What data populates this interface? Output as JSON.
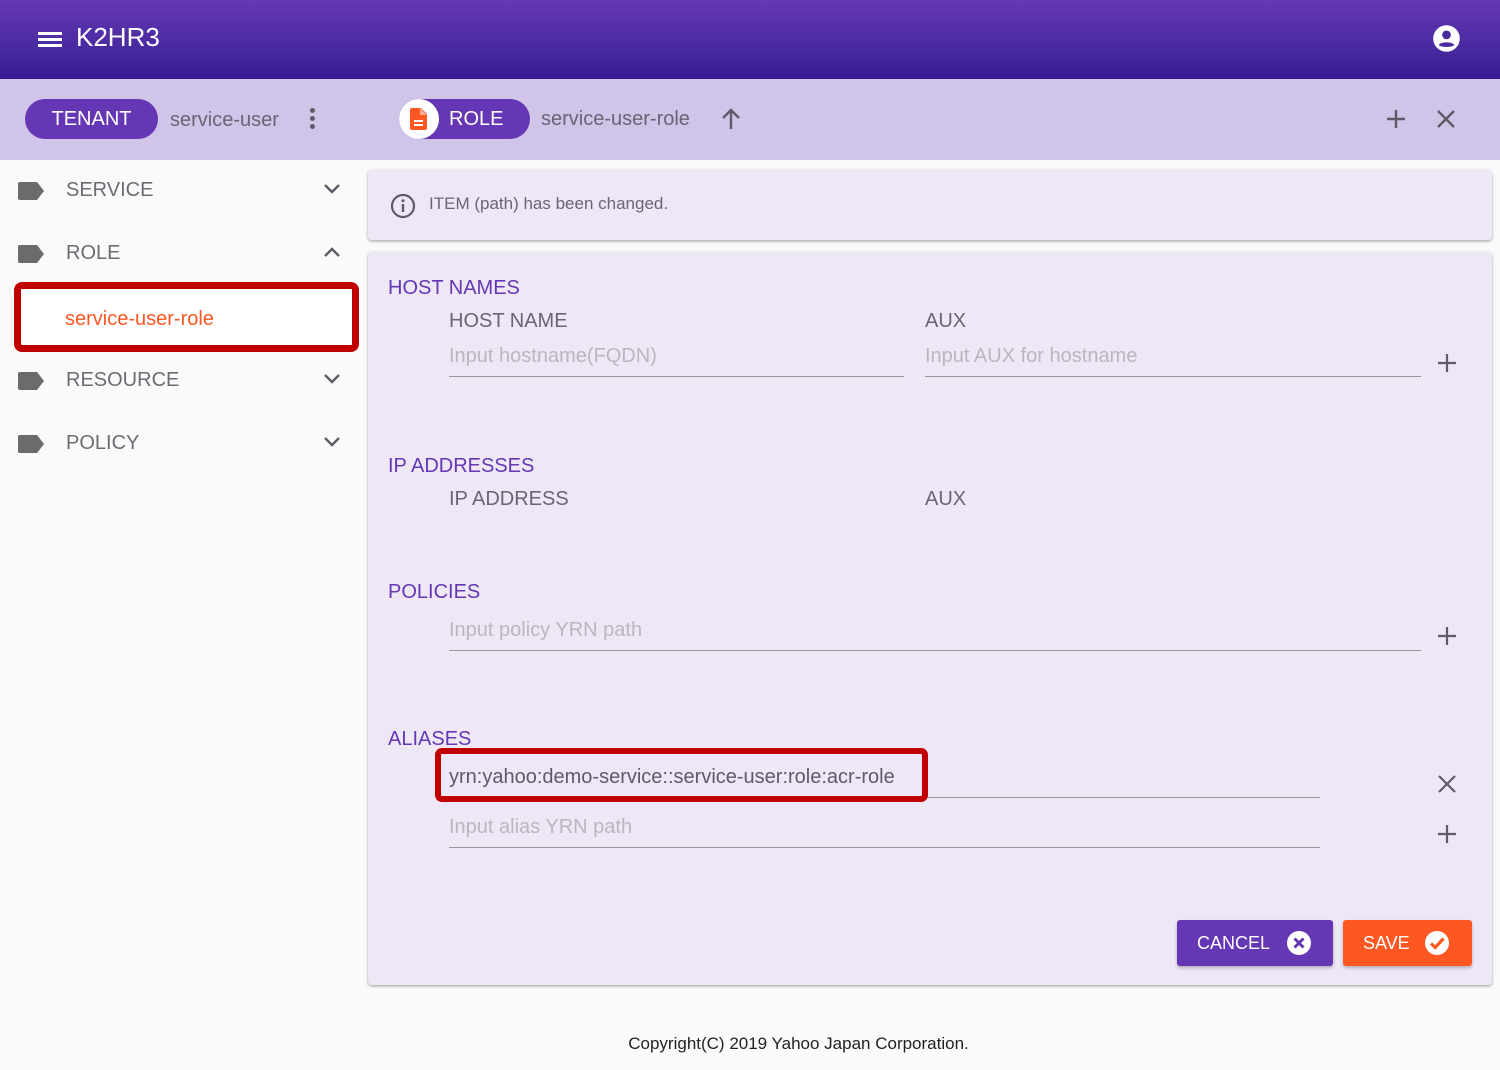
{
  "app": {
    "title": "K2HR3",
    "icons": {
      "menu": "menu-icon",
      "account": "account-circle-icon"
    }
  },
  "toolbar": {
    "tenant_chip": "TENANT",
    "tenant_name": "service-user",
    "role_chip": "ROLE",
    "role_name": "service-user-role",
    "icons": {
      "tenant_menu": "more-vert-icon",
      "role_avatar": "document-icon",
      "up": "arrow-up-icon",
      "add": "plus-icon",
      "close": "close-icon"
    }
  },
  "sidebar": {
    "items": [
      {
        "label": "SERVICE",
        "expanded": false
      },
      {
        "label": "ROLE",
        "expanded": true,
        "children": [
          "service-user-role"
        ]
      },
      {
        "label": "RESOURCE",
        "expanded": false
      },
      {
        "label": "POLICY",
        "expanded": false
      }
    ]
  },
  "info": {
    "message": "ITEM (path) has been changed."
  },
  "form": {
    "host_names": {
      "title": "HOST NAMES",
      "col_host": "HOST NAME",
      "col_aux": "AUX",
      "host_placeholder": "Input hostname(FQDN)",
      "aux_placeholder": "Input AUX for hostname"
    },
    "ip_addresses": {
      "title": "IP ADDRESSES",
      "col_ip": "IP ADDRESS",
      "col_aux": "AUX"
    },
    "policies": {
      "title": "POLICIES",
      "placeholder": "Input policy YRN path"
    },
    "aliases": {
      "title": "ALIASES",
      "values": [
        "yrn:yahoo:demo-service::service-user:role:acr-role"
      ],
      "placeholder": "Input alias YRN path"
    },
    "cancel_label": "CANCEL",
    "save_label": "SAVE"
  },
  "colors": {
    "primary": "#6537b4",
    "accent": "#ff5722",
    "highlight": "#c00000"
  },
  "footer": {
    "copyright": "Copyright(C) 2019 Yahoo Japan Corporation."
  }
}
